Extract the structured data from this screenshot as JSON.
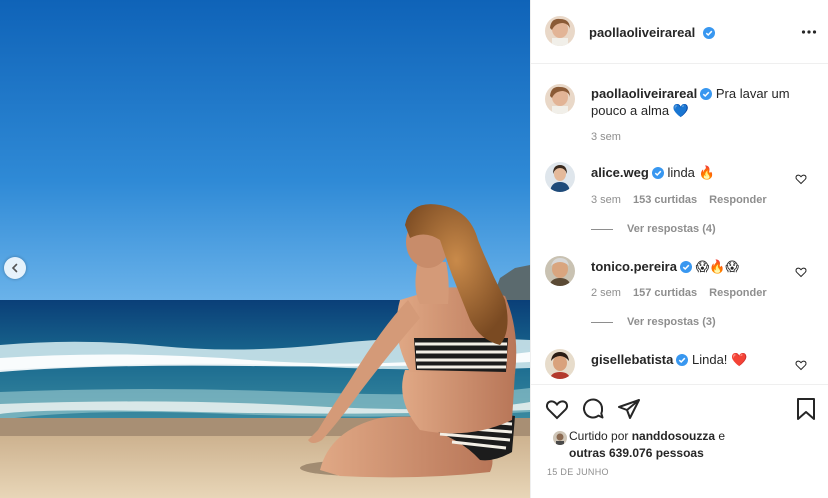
{
  "post_author": {
    "username": "paollaoliveirareal",
    "more_icon": "more-horizontal-icon"
  },
  "caption": {
    "username": "paollaoliveirareal",
    "text": "Pra lavar um pouco a alma 💙",
    "time": "3 sem"
  },
  "comments": [
    {
      "username": "alice.weg",
      "text": "linda 🔥",
      "time": "3 sem",
      "likes": "153 curtidas",
      "reply": "Responder",
      "view_replies": "Ver respostas (4)"
    },
    {
      "username": "tonico.pereira",
      "text": "😱🔥😱",
      "time": "2 sem",
      "likes": "157 curtidas",
      "reply": "Responder",
      "view_replies": "Ver respostas (3)"
    },
    {
      "username": "gisellebatista",
      "text": "Linda! ❤️"
    }
  ],
  "likes": {
    "prefix": "Curtido por",
    "user": "nanddosouzza",
    "connector": "e",
    "others": "outras 639.076 pessoas"
  },
  "date": "15 DE JUNHO",
  "colors": {
    "verified": "#3897f0",
    "text": "#262626",
    "muted": "#8e8e8e",
    "border": "#efefef"
  }
}
